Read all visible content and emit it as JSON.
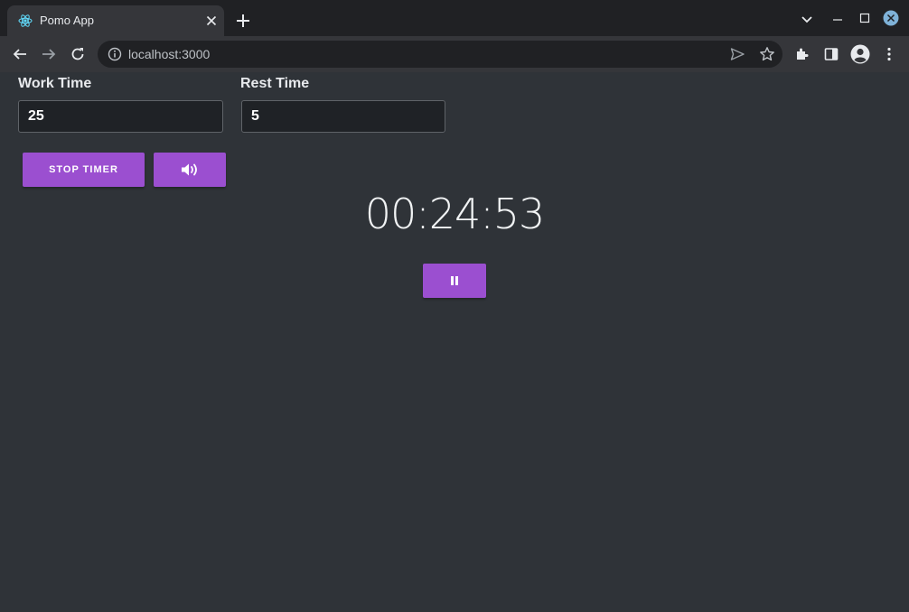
{
  "browser": {
    "tab_title": "Pomo App",
    "url": "localhost:3000",
    "favicon": "react-logo-icon"
  },
  "colors": {
    "accent": "#9b4fd0",
    "page_bg": "#2f3338",
    "input_bg": "#1f2226"
  },
  "settings": {
    "work_label": "Work Time",
    "work_value": "25",
    "rest_label": "Rest Time",
    "rest_value": "5"
  },
  "controls": {
    "stop_label": "STOP TIMER",
    "sound_icon": "volume-up-icon",
    "pause_icon": "pause-icon"
  },
  "timer": {
    "display": "00:24:53"
  }
}
